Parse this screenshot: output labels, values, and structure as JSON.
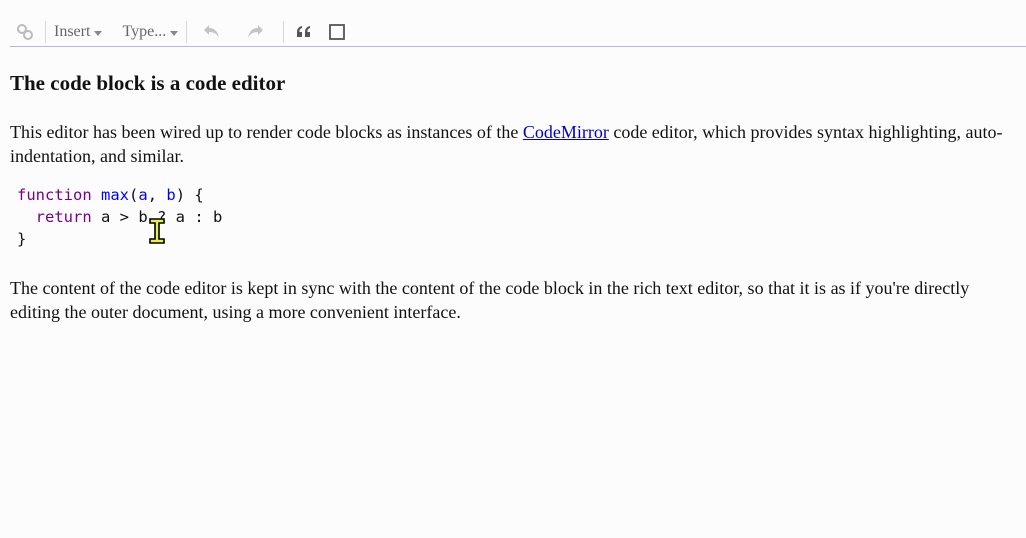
{
  "menubar": {
    "insert_label": "Insert",
    "type_label": "Type...",
    "icons": [
      "join-up-icon",
      "undo-icon",
      "redo-icon",
      "blockquote-icon",
      "select-parent-icon"
    ]
  },
  "doc": {
    "heading": "The code block is a code editor",
    "p1_before": "This editor has been wired up to render code blocks as instances of the ",
    "p1_link": "CodeMirror",
    "p1_after": " code editor, which provides syntax highlighting, auto-indentation, and similar.",
    "code": {
      "l1_kw": "function",
      "l1_def": "max",
      "l1_p1": "(",
      "l1_a": "a",
      "l1_comma": ", ",
      "l1_b": "b",
      "l1_end": ") {",
      "l2_indent": "  ",
      "l2_kw": "return",
      "l2_rest": " a > b ? a : b",
      "l3": "}"
    },
    "p2": "The content of the code editor is kept in sync with the content of the code block in the rich text editor, so that it is as if you're directly editing the outer document, using a more convenient interface."
  },
  "colors": {
    "keyword": "#770088",
    "definition": "#0000ff",
    "variable": "#0055aa",
    "link": "#0000cc",
    "menubar_border": "#b9b7cc"
  }
}
